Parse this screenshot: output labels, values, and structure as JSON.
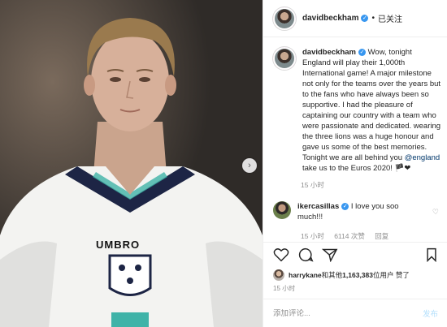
{
  "post": {
    "image_alt": "",
    "jersey_brand": "UMBRO"
  },
  "header": {
    "username": "davidbeckham",
    "dot": "•",
    "follow_state": "已关注"
  },
  "caption": {
    "username": "davidbeckham",
    "text_before_mention": "Wow, tonight England will play their 1,000th International game! A major milestone not only for the teams over the years but to the fans who have always been so supportive. I had the pleasure of captaining our country with a team who were passionate and dedicated. wearing the three lions was a huge honour and gave us some of the best memories. Tonight we are all behind you ",
    "mention": "@england",
    "text_after_mention": " take us to the Euros 2020! 🏴❤",
    "time": "15 小时"
  },
  "comment": {
    "username": "ikercasillas",
    "text": "I love you soo much!!!",
    "time": "15 小时",
    "likes": "6114 次赞",
    "reply": "回复"
  },
  "likes": {
    "user": "harrykane",
    "connector": " 和 ",
    "others_prefix": "其他 ",
    "count": "1,163,383",
    "suffix": " 位用户 赞了"
  },
  "post_time": "15 小时",
  "add_comment": {
    "placeholder": "添加评论...",
    "post_label": "发布"
  },
  "colors": {
    "verified": "#3897f0",
    "mention": "#00376b",
    "secondary_text": "#8e8e8e",
    "post_button_disabled": "#b2dffc"
  }
}
